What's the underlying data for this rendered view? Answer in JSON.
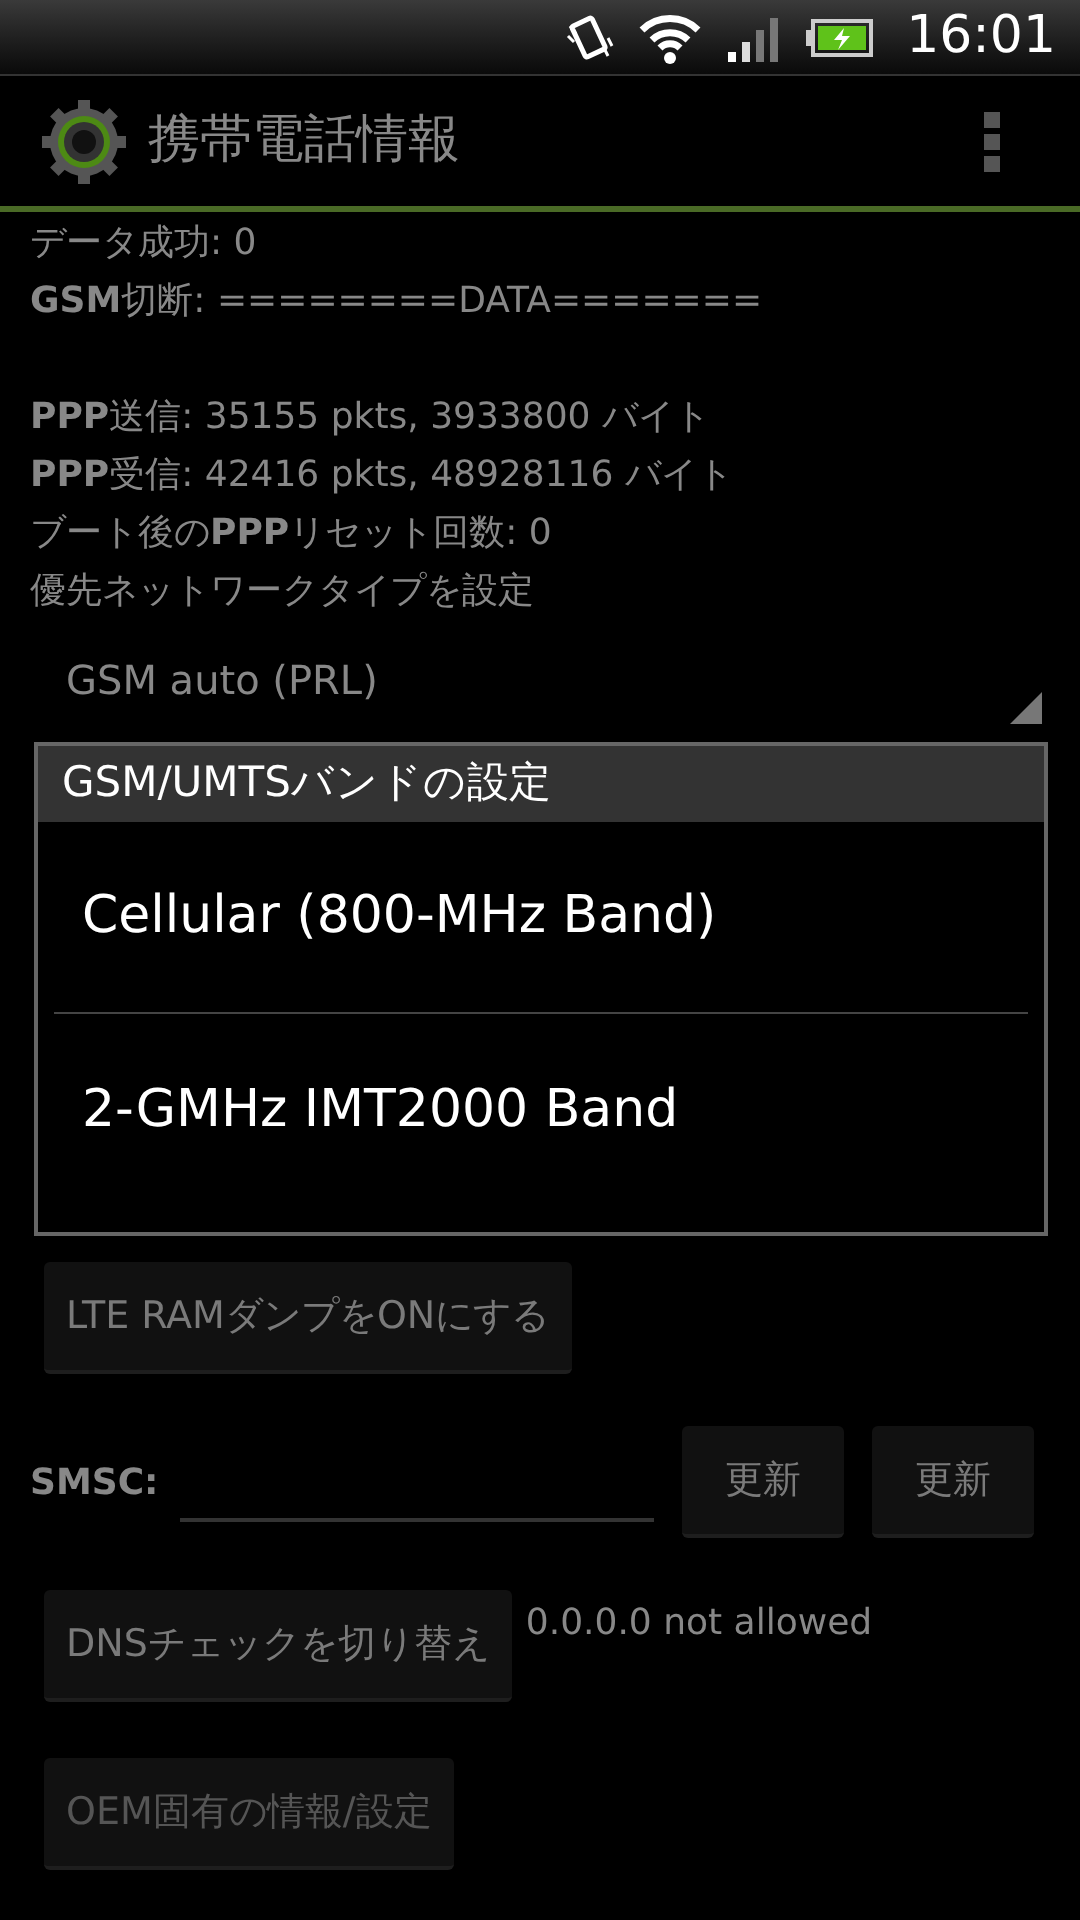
{
  "status_bar": {
    "time": "16:01"
  },
  "action_bar": {
    "title": "携帯電話情報"
  },
  "info_lines": [
    "データ成功: 0",
    "**GSM**切断: ========DATA======="
  ],
  "traffic_lines": [
    "**PPP**送信: 35155 pkts, 3933800 バイト",
    "**PPP**受信: 42416 pkts, 48928116 バイト",
    "ブート後の**PPP**リセット回数: 0",
    "優先ネットワークタイプを設定"
  ],
  "network_type_spinner": {
    "value": "GSM auto (PRL)"
  },
  "lte_button": {
    "label": "LTE RAMダンプをONにする",
    "disabled": false
  },
  "smsc": {
    "label": "SMSC:",
    "buttons": [
      {
        "label": "更新",
        "disabled": false
      },
      {
        "label": "更新",
        "disabled": false
      }
    ]
  },
  "dns_button": {
    "label": "DNSチェックを切り替え",
    "disabled": false
  },
  "dns_status": "0.0.0.0 not allowed",
  "oem_button": {
    "label": "OEM固有の情報/設定",
    "disabled": true
  },
  "dialog": {
    "title": "GSM/UMTSバンドの設定",
    "options": [
      {
        "label": "Cellular (800-MHz Band)"
      },
      {
        "label": "2-GMHz IMT2000 Band"
      }
    ]
  }
}
